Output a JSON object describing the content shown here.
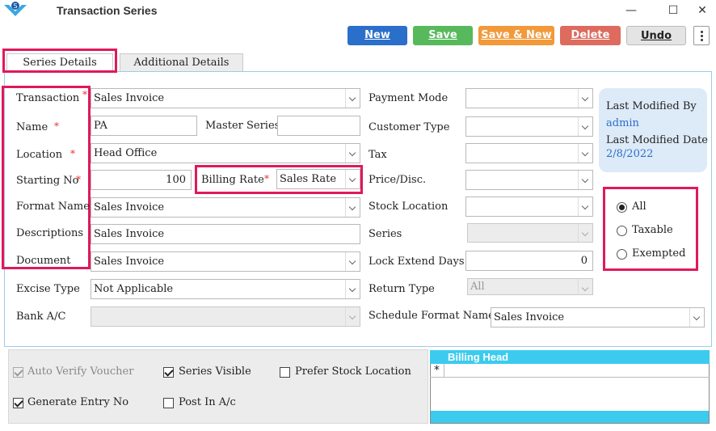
{
  "window": {
    "title": "Transaction Series",
    "minimize": "—",
    "maximize": "☐",
    "close": "✕"
  },
  "toolbar": {
    "new_label": "New",
    "save_label": "Save",
    "save_new_label": "Save & New",
    "delete_label": "Delete",
    "undo_label": "Undo"
  },
  "tabs": [
    "Series Details",
    "Additional Details"
  ],
  "left_form": {
    "transaction": {
      "label": "Transaction",
      "value": "Sales Invoice"
    },
    "name": {
      "label": "Name",
      "value": "PA"
    },
    "master_series": {
      "label": "Master Series",
      "value": ""
    },
    "location": {
      "label": "Location",
      "value": "Head Office"
    },
    "starting_no": {
      "label": "Starting No",
      "value": "100"
    },
    "billing_rate": {
      "label": "Billing Rate",
      "value": "Sales Rate"
    },
    "format_name": {
      "label": "Format Name",
      "value": "Sales Invoice"
    },
    "descriptions": {
      "label": "Descriptions",
      "value": "Sales Invoice"
    },
    "document": {
      "label": "Document",
      "value": "Sales Invoice"
    },
    "excise_type": {
      "label": "Excise Type",
      "value": "Not Applicable"
    },
    "bank_ac": {
      "label": "Bank A/C",
      "value": ""
    }
  },
  "right_form": {
    "payment_mode": {
      "label": "Payment Mode",
      "value": ""
    },
    "customer_type": {
      "label": "Customer Type",
      "value": ""
    },
    "tax": {
      "label": "Tax",
      "value": ""
    },
    "price_disc": {
      "label": "Price/Disc.",
      "value": ""
    },
    "stock_location": {
      "label": "Stock Location",
      "value": ""
    },
    "series": {
      "label": "Series",
      "value": ""
    },
    "lock_extend_days": {
      "label": "Lock Extend Days",
      "value": "0"
    },
    "return_type": {
      "label": "Return Type",
      "value": "All"
    },
    "schedule_format_name": {
      "label": "Schedule Format Name",
      "value": "Sales Invoice"
    }
  },
  "required_mark": "*",
  "info": {
    "last_modified_by_label": "Last Modified By",
    "last_modified_by": "admin",
    "last_modified_date_label": "Last Modified Date",
    "last_modified_date": "2/8/2022"
  },
  "tax_filter": {
    "options": [
      "All",
      "Taxable",
      "Exempted"
    ],
    "selected": "All"
  },
  "options": {
    "auto_verify_voucher": {
      "label": "Auto Verify Voucher",
      "checked": true,
      "disabled": true
    },
    "series_visible": {
      "label": "Series Visible",
      "checked": true
    },
    "prefer_stock_location": {
      "label": "Prefer Stock Location",
      "checked": false
    },
    "generate_entry_no": {
      "label": "Generate Entry No",
      "checked": true
    },
    "post_in_ac": {
      "label": "Post In A/c",
      "checked": false
    }
  },
  "billing_grid": {
    "header": "Billing Head",
    "new_row_marker": "*"
  },
  "colors": {
    "accent_blue": "#2a6fc9",
    "save_green": "#58b95c",
    "save_new_orange": "#f2993a",
    "delete_red": "#dd6b5e",
    "highlight_pink": "#e0195c",
    "grid_header": "#3ccbee"
  }
}
